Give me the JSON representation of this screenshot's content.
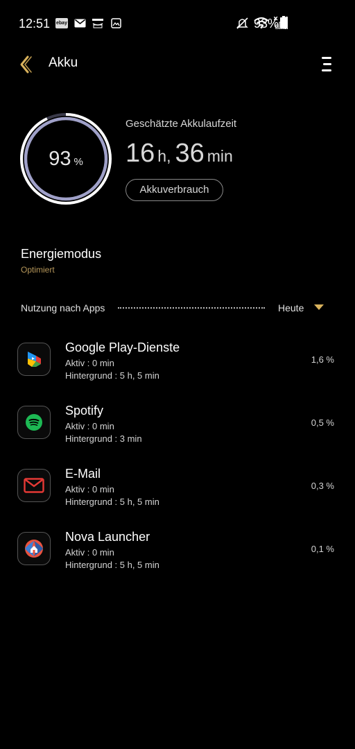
{
  "status_bar": {
    "time": "12:51",
    "battery_percent": "93%",
    "notification_icons": [
      "ebay-icon",
      "mail-icon",
      "amazon-icon",
      "gallery-icon"
    ],
    "system_icons": [
      "mute-icon",
      "wifi-icon",
      "signal-icon",
      "battery-icon"
    ]
  },
  "header": {
    "title": "Akku",
    "accent_color": "#d9b25c"
  },
  "battery": {
    "level": 0.93,
    "percent_value": "93",
    "percent_unit": "%",
    "estimate_label": "Geschätzte Akkulaufzeit",
    "hours": "16",
    "hours_unit": "h,",
    "minutes": "36",
    "minutes_unit": "min",
    "usage_button": "Akkuverbrauch"
  },
  "power_mode": {
    "title": "Energiemodus",
    "value": "Optimiert"
  },
  "usage": {
    "label": "Nutzung nach Apps",
    "period": "Heute"
  },
  "apps": [
    {
      "name": "Google Play-Dienste",
      "active": "Aktiv : 0 min",
      "background": "Hintergrund : 5 h, 5 min",
      "percent": "1,6 %",
      "icon": "google-play-services-icon"
    },
    {
      "name": "Spotify",
      "active": "Aktiv : 0 min",
      "background": "Hintergrund : 3 min",
      "percent": "0,5 %",
      "icon": "spotify-icon"
    },
    {
      "name": "E-Mail",
      "active": "Aktiv : 0 min",
      "background": "Hintergrund : 5 h, 5 min",
      "percent": "0,3 %",
      "icon": "email-icon"
    },
    {
      "name": "Nova Launcher",
      "active": "Aktiv : 0 min",
      "background": "Hintergrund : 5 h, 5 min",
      "percent": "0,1 %",
      "icon": "nova-launcher-icon"
    }
  ]
}
